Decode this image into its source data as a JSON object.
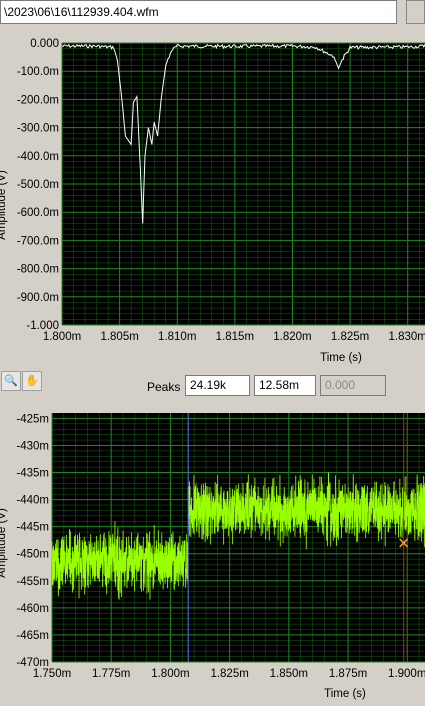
{
  "file_path": "\\2023\\06\\16\\112939.404.wfm",
  "peaks": {
    "label": "Peaks",
    "value1": "24.19k",
    "value2": "12.58m",
    "value3": "0.000"
  },
  "chart_data": [
    {
      "type": "line",
      "xlabel": "Time (s)",
      "ylabel": "Amplitude (V)",
      "x_ticks": [
        "1.800m",
        "1.805m",
        "1.810m",
        "1.815m",
        "1.820m",
        "1.825m",
        "1.830m"
      ],
      "y_ticks": [
        "0.000",
        "-100.0m",
        "-200.0m",
        "-300.0m",
        "-400.0m",
        "-500.0m",
        "-600.0m",
        "-700.0m",
        "-800.0m",
        "-900.0m",
        "-1.000"
      ],
      "xlim": [
        1.8,
        1.8315
      ],
      "ylim": [
        -1.0,
        0.0
      ],
      "x_unit": "ms",
      "y_unit": "V",
      "grid": true,
      "background": "#000000",
      "grid_color": "#1e8a1e",
      "line_color": "#ffffff",
      "series": [
        {
          "x": [
            1.8,
            1.803,
            1.8045,
            1.8048,
            1.8052,
            1.8055,
            1.806,
            1.8062,
            1.8065,
            1.8068,
            1.807,
            1.8072,
            1.8075,
            1.8078,
            1.808,
            1.8083,
            1.8086,
            1.809,
            1.8095,
            1.81,
            1.815,
            1.82,
            1.822,
            1.8235,
            1.824,
            1.8245,
            1.825,
            1.83,
            1.8315
          ],
          "y": [
            -0.005,
            -0.005,
            -0.01,
            -0.06,
            -0.2,
            -0.33,
            -0.36,
            -0.21,
            -0.19,
            -0.45,
            -0.64,
            -0.4,
            -0.3,
            -0.36,
            -0.28,
            -0.33,
            -0.2,
            -0.08,
            -0.02,
            -0.005,
            -0.006,
            -0.005,
            -0.008,
            -0.04,
            -0.09,
            -0.04,
            -0.01,
            -0.008,
            -0.005
          ]
        }
      ]
    },
    {
      "type": "line",
      "xlabel": "Time (s)",
      "ylabel": "Amplitude (V)",
      "x_ticks": [
        "1.750m",
        "1.775m",
        "1.800m",
        "1.825m",
        "1.850m",
        "1.875m",
        "1.900m"
      ],
      "y_ticks": [
        "-425m",
        "-430m",
        "-435m",
        "-440m",
        "-445m",
        "-450m",
        "-455m",
        "-460m",
        "-465m",
        "-470m"
      ],
      "xlim": [
        1.75,
        1.9075
      ],
      "ylim": [
        -0.47,
        -0.424
      ],
      "x_unit": "ms",
      "y_unit": "V",
      "grid": true,
      "background": "#000000",
      "grid_color": "#1e8a1e",
      "line_color": "#99ff00",
      "series": [
        {
          "name": "",
          "segments": [
            {
              "x_range": [
                1.75,
                1.8075
              ],
              "mean": -0.4515,
              "spread": 0.008
            },
            {
              "x_range": [
                1.8075,
                1.9075
              ],
              "mean": -0.442,
              "spread": 0.008
            }
          ]
        }
      ],
      "cursors": [
        {
          "x": 1.8075,
          "color": "#5577ff"
        },
        {
          "x": 1.8985,
          "y": -0.448,
          "color": "#e01010",
          "marker_color": "#ffa020"
        }
      ]
    }
  ]
}
